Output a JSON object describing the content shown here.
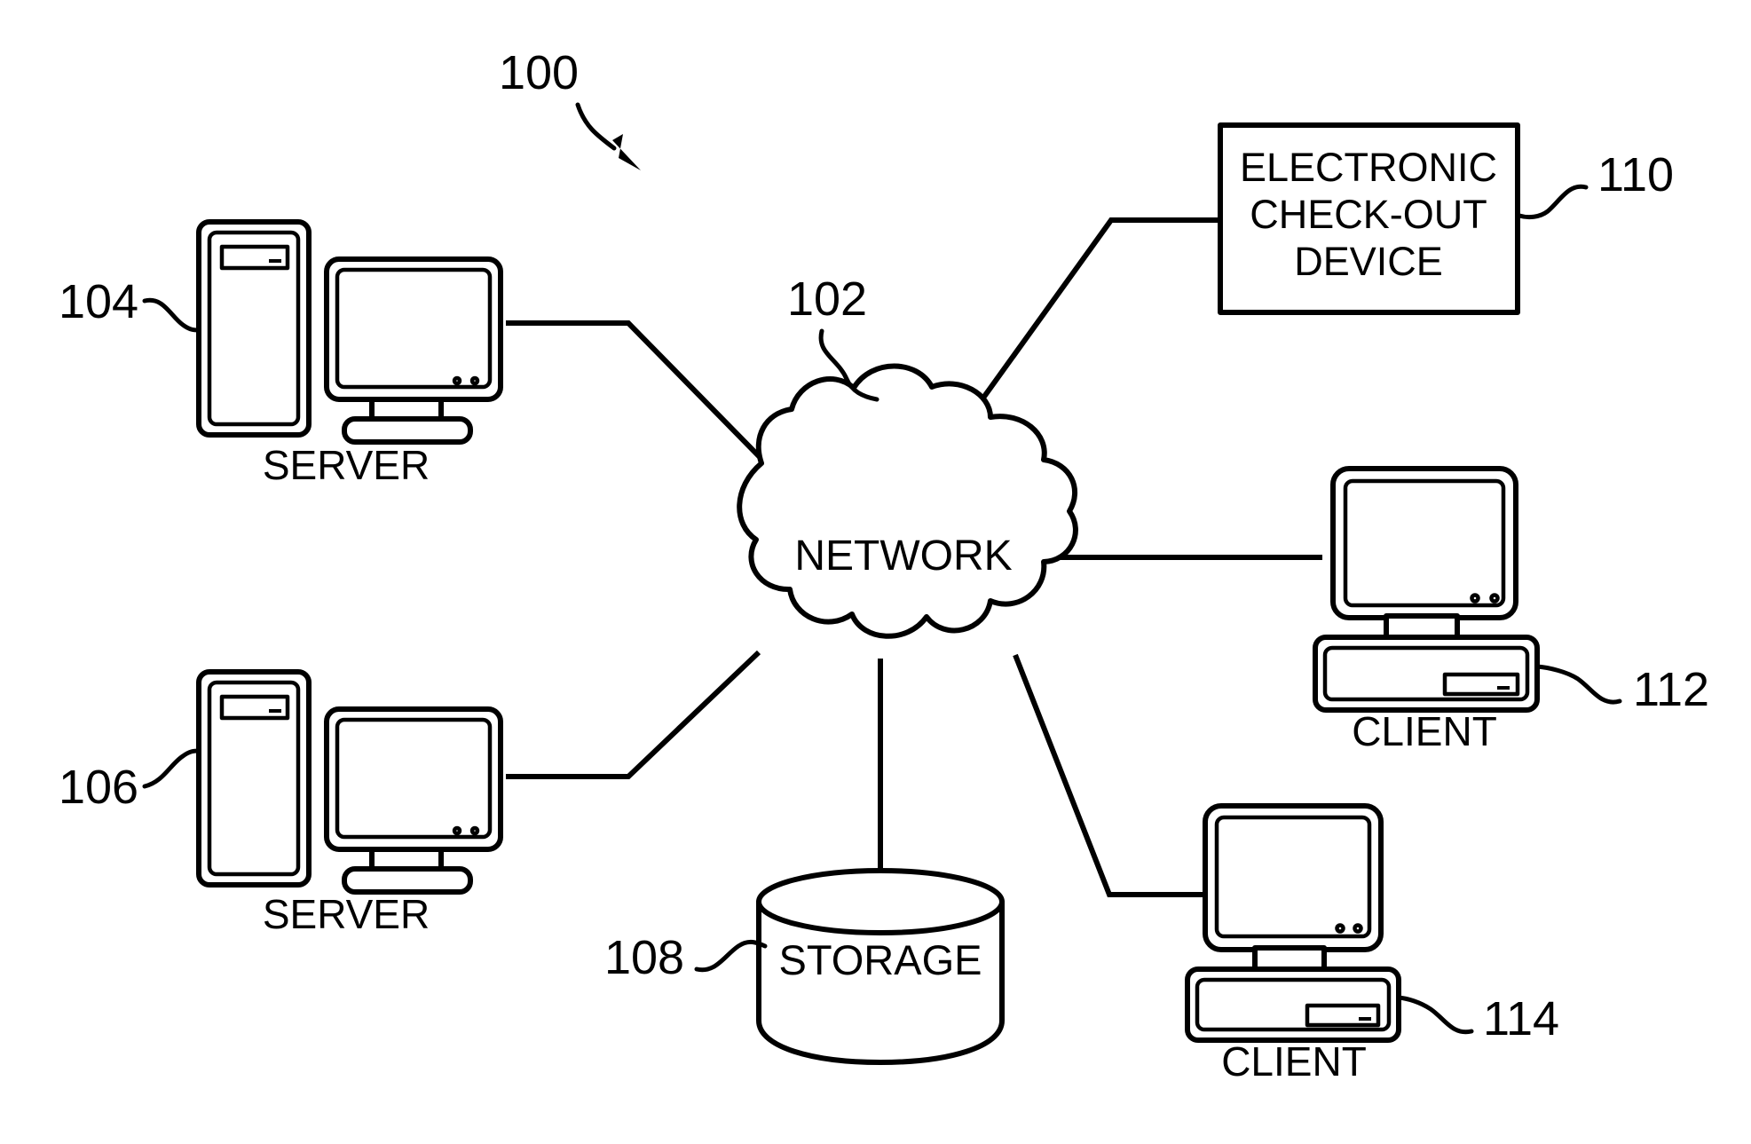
{
  "figure": {
    "type": "patent-network-diagram",
    "figure_reference": "100",
    "background_color": "#ffffff",
    "line_color": "#000000"
  },
  "nodes": {
    "network": {
      "label": "NETWORK",
      "reference": "102",
      "icon": "cloud-icon"
    },
    "server_top": {
      "label": "SERVER",
      "reference": "104",
      "icon": "server-tower-and-monitor-icon"
    },
    "server_bottom": {
      "label": "SERVER",
      "reference": "106",
      "icon": "server-tower-and-monitor-icon"
    },
    "storage": {
      "label": "STORAGE",
      "reference": "108",
      "icon": "database-cylinder-icon"
    },
    "checkout_device": {
      "label_line1": "ELECTRONIC",
      "label_line2": "CHECK-OUT",
      "label_line3": "DEVICE",
      "reference": "110",
      "icon": "rectangle-box-icon"
    },
    "client_top": {
      "label": "CLIENT",
      "reference": "112",
      "icon": "desktop-computer-icon"
    },
    "client_bottom": {
      "label": "CLIENT",
      "reference": "114",
      "icon": "desktop-computer-icon"
    }
  },
  "connections": [
    {
      "from": "server_top",
      "to": "network"
    },
    {
      "from": "server_bottom",
      "to": "network"
    },
    {
      "from": "checkout_device",
      "to": "network"
    },
    {
      "from": "client_top",
      "to": "network"
    },
    {
      "from": "client_bottom",
      "to": "network"
    },
    {
      "from": "storage",
      "to": "network"
    }
  ]
}
